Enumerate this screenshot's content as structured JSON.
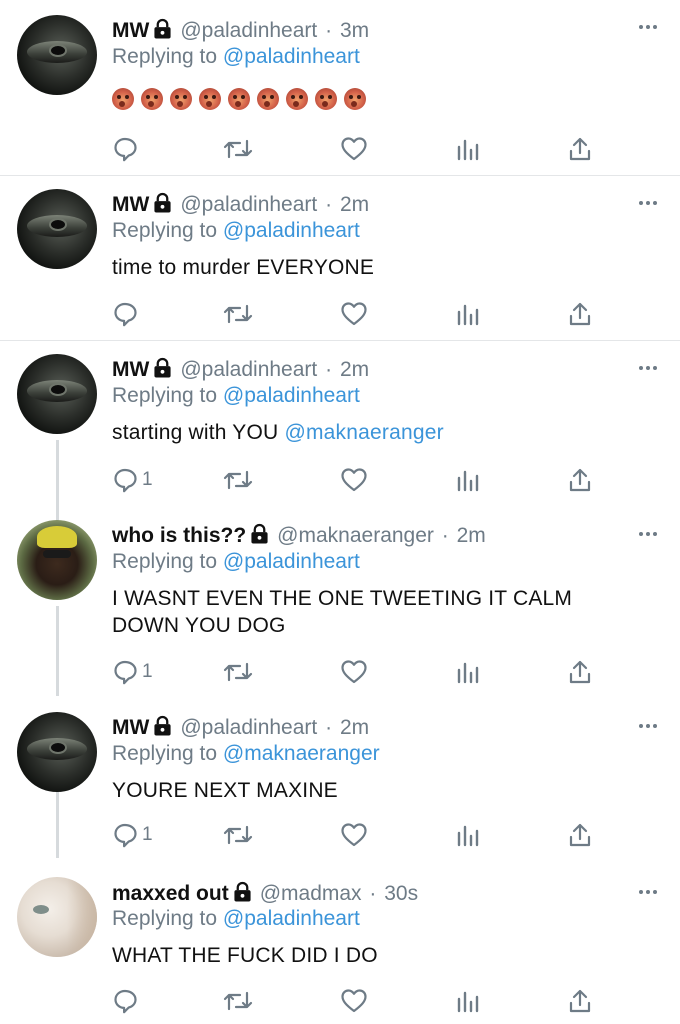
{
  "tweets": [
    {
      "name": "MW",
      "handle": "@paladinheart",
      "time": "3m",
      "replying_prefix": "Replying to ",
      "replying_to": "@paladinheart",
      "text": "",
      "emoji_count": 9,
      "emoji_name": "ogre-face",
      "reply_count": ""
    },
    {
      "name": "MW",
      "handle": "@paladinheart",
      "time": "2m",
      "replying_prefix": "Replying to ",
      "replying_to": "@paladinheart",
      "text": "time to murder EVERYONE",
      "reply_count": ""
    },
    {
      "name": "MW",
      "handle": "@paladinheart",
      "time": "2m",
      "replying_prefix": "Replying to ",
      "replying_to": "@paladinheart",
      "text": "starting with YOU ",
      "mention": "@maknaeranger",
      "reply_count": "1"
    },
    {
      "name": "who is this??",
      "handle": "@maknaeranger",
      "time": "2m",
      "replying_prefix": "Replying to ",
      "replying_to": "@paladinheart",
      "text": "I WASNT EVEN THE ONE TWEETING IT CALM DOWN YOU DOG",
      "reply_count": "1"
    },
    {
      "name": "MW",
      "handle": "@paladinheart",
      "time": "2m",
      "replying_prefix": "Replying to ",
      "replying_to": "@maknaeranger",
      "text": "YOURE NEXT MAXINE",
      "reply_count": "1"
    },
    {
      "name": "maxxed out",
      "handle": "@madmax",
      "time": "30s",
      "replying_prefix": "Replying to ",
      "replying_to": "@paladinheart",
      "text": "WHAT THE FUCK DID I DO",
      "reply_count": ""
    }
  ],
  "separator": "·",
  "icons": {
    "reply": "reply-icon",
    "retweet": "retweet-icon",
    "like": "heart-icon",
    "stats": "analytics-icon",
    "share": "share-icon",
    "more": "more-icon",
    "lock": "lock-icon"
  },
  "colors": {
    "link": "#3b94d9",
    "muted": "#6e7b86",
    "text": "#111111",
    "divider": "#e4e6e8"
  }
}
